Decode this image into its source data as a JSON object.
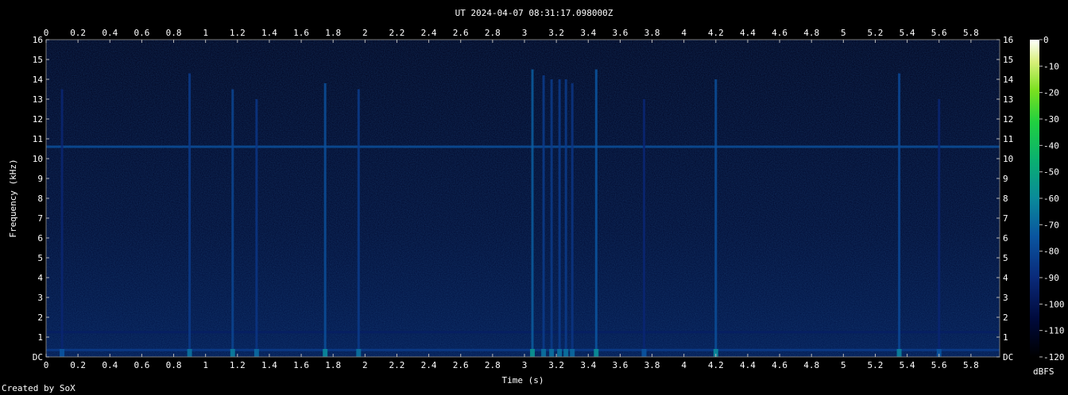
{
  "chart_data": {
    "type": "heatmap",
    "title": "UT 2024-04-07 08:31:17.098000Z",
    "xlabel": "Time (s)",
    "ylabel": "Frequency (kHz)",
    "colorbar_label": "dBFS",
    "footer": "Created by SoX",
    "xlim": [
      0,
      5.98
    ],
    "ylim": [
      0,
      16
    ],
    "x_ticks": [
      "0",
      "0.2",
      "0.4",
      "0.6",
      "0.8",
      "1",
      "1.2",
      "1.4",
      "1.6",
      "1.8",
      "2",
      "2.2",
      "2.4",
      "2.6",
      "2.8",
      "3",
      "3.2",
      "3.4",
      "3.6",
      "3.8",
      "4",
      "4.2",
      "4.4",
      "4.6",
      "4.8",
      "5",
      "5.2",
      "5.4",
      "5.6",
      "5.8"
    ],
    "x_tick_values": [
      0,
      0.2,
      0.4,
      0.6,
      0.8,
      1,
      1.2,
      1.4,
      1.6,
      1.8,
      2,
      2.2,
      2.4,
      2.6,
      2.8,
      3,
      3.2,
      3.4,
      3.6,
      3.8,
      4,
      4.2,
      4.4,
      4.6,
      4.8,
      5,
      5.2,
      5.4,
      5.6,
      5.8
    ],
    "y_ticks": [
      "DC",
      "1",
      "2",
      "3",
      "4",
      "5",
      "6",
      "7",
      "8",
      "9",
      "10",
      "11",
      "12",
      "13",
      "14",
      "15",
      "16"
    ],
    "colorbar_ticks": [
      "0",
      "-10",
      "-20",
      "-30",
      "-40",
      "-50",
      "-60",
      "-70",
      "-80",
      "-90",
      "-100",
      "-110",
      "-120"
    ],
    "colorbar_range": [
      -120,
      0
    ],
    "colormap": [
      "#000000",
      "#000a3c",
      "#0a2a7a",
      "#0a55a0",
      "#0a8a9a",
      "#0ab070",
      "#20d040",
      "#7ae020",
      "#d8f07a",
      "#ffffff"
    ],
    "background_level_dbfs": -105,
    "horizontal_lines": [
      {
        "freq_khz": 10.6,
        "level_dbfs": -82
      },
      {
        "freq_khz": 1.25,
        "level_dbfs": -98
      },
      {
        "freq_khz": 0.35,
        "level_dbfs": -88
      }
    ],
    "vertical_events": [
      {
        "time_s": 0.1,
        "max_khz": 13.5,
        "level_dbfs": -95
      },
      {
        "time_s": 0.9,
        "max_khz": 14.3,
        "level_dbfs": -88
      },
      {
        "time_s": 1.17,
        "max_khz": 13.5,
        "level_dbfs": -85
      },
      {
        "time_s": 1.32,
        "max_khz": 13.0,
        "level_dbfs": -90
      },
      {
        "time_s": 1.75,
        "max_khz": 13.8,
        "level_dbfs": -82
      },
      {
        "time_s": 1.96,
        "max_khz": 13.5,
        "level_dbfs": -88
      },
      {
        "time_s": 3.05,
        "max_khz": 14.5,
        "level_dbfs": -78
      },
      {
        "time_s": 3.12,
        "max_khz": 14.2,
        "level_dbfs": -88
      },
      {
        "time_s": 3.17,
        "max_khz": 14.0,
        "level_dbfs": -88
      },
      {
        "time_s": 3.22,
        "max_khz": 14.0,
        "level_dbfs": -88
      },
      {
        "time_s": 3.26,
        "max_khz": 14.0,
        "level_dbfs": -88
      },
      {
        "time_s": 3.3,
        "max_khz": 13.8,
        "level_dbfs": -90
      },
      {
        "time_s": 3.45,
        "max_khz": 14.5,
        "level_dbfs": -80
      },
      {
        "time_s": 3.75,
        "max_khz": 13.0,
        "level_dbfs": -95
      },
      {
        "time_s": 4.2,
        "max_khz": 14.0,
        "level_dbfs": -82
      },
      {
        "time_s": 5.35,
        "max_khz": 14.3,
        "level_dbfs": -84
      },
      {
        "time_s": 5.6,
        "max_khz": 13.0,
        "level_dbfs": -95
      }
    ]
  }
}
